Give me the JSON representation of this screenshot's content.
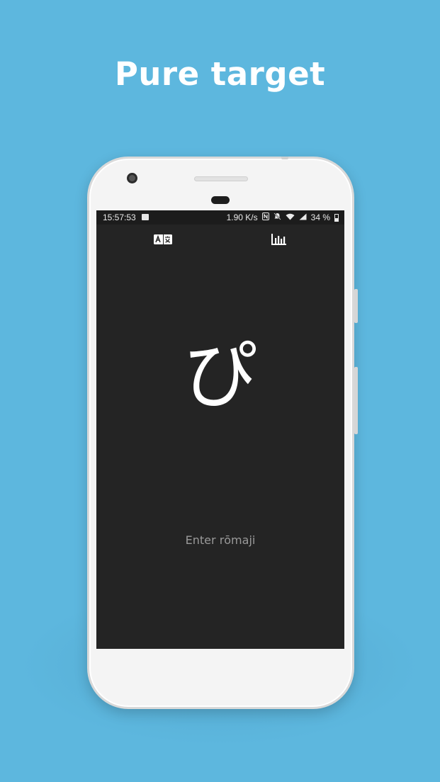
{
  "headline": "Pure target",
  "status_bar": {
    "time": "15:57:53",
    "network_speed": "1.90 K/s",
    "battery": "34 %",
    "icons": [
      "image-icon",
      "nfc-icon",
      "mute-icon",
      "wifi-icon",
      "signal-icon",
      "battery-icon"
    ]
  },
  "toolbar": {
    "icons": [
      "translate-icon",
      "stats-chart-icon"
    ]
  },
  "quiz": {
    "kana": "ぴ",
    "input_placeholder": "Enter rōmaji"
  },
  "colors": {
    "background": "#5db7de",
    "screen": "#242424",
    "text": "#ffffff"
  }
}
